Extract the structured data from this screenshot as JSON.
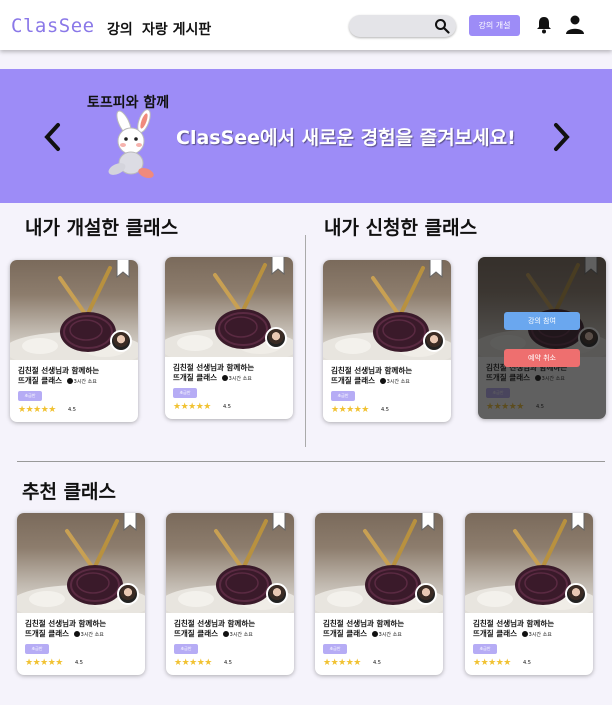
{
  "header": {
    "logo": "ClasSee",
    "nav": [
      "강의",
      "자랑 게시판"
    ],
    "search_placeholder": "",
    "open_course_button": "강의 개설",
    "icons": [
      "search-icon",
      "bell-icon",
      "user-icon"
    ]
  },
  "banner": {
    "small_text": "토프피와 함께",
    "main_text": "ClasSee에서 새로운 경험을 즐겨보세요!",
    "background": "#9d8cf7"
  },
  "sections": {
    "opened": "내가 개설한 클래스",
    "applied": "내가 신청한 클래스",
    "recommended": "추천 클래스"
  },
  "course": {
    "title_line1": "김친절 선생님과 함께하는",
    "title_line2": "뜨개질 클래스",
    "duration": "3시간 소요",
    "tag": "초급반",
    "stars": "★★★★★",
    "rating": "4.5"
  },
  "overlay": {
    "join_button": "강의 참여",
    "cancel_button": "예약 취소"
  },
  "colors": {
    "accent": "#9d8cf7",
    "logo": "#8a78e8",
    "join": "#6aa7ef",
    "cancel": "#ee6f6f",
    "star": "#f1c232"
  }
}
